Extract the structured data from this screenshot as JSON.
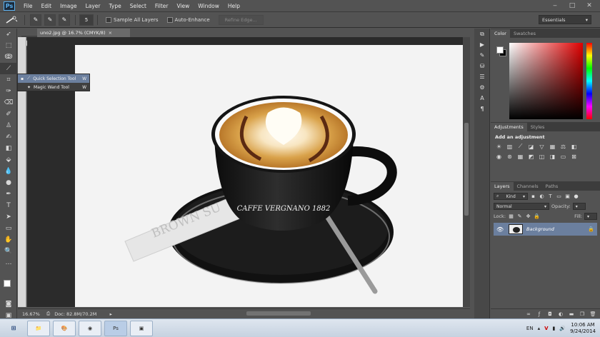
{
  "app": {
    "logo": "Ps"
  },
  "menu": [
    "File",
    "Edit",
    "Image",
    "Layer",
    "Type",
    "Select",
    "Filter",
    "View",
    "Window",
    "Help"
  ],
  "window_controls": {
    "minimize": "‒",
    "maximize": "□",
    "close": "✕"
  },
  "options_bar": {
    "brush_size": "5",
    "sample_all_layers": "Sample All Layers",
    "auto_enhance": "Auto-Enhance",
    "refine_edge": "Refine Edge...",
    "workspace": "Essentials"
  },
  "document": {
    "tab_title": "uno2.jpg @ 16.7% (CMYK/8)",
    "zoom": "16.67%",
    "doc_size": "Doc: 82.8M/70.2M"
  },
  "tool_flyout": {
    "items": [
      {
        "label": "Quick Selection Tool",
        "key": "W",
        "selected": true
      },
      {
        "label": "Magic Wand Tool",
        "key": "W",
        "selected": false
      }
    ]
  },
  "photo": {
    "cup_brand": "CAFFE VERGNANO 1882",
    "sugar_text": "BROWN SU"
  },
  "panels": {
    "color_tabs": [
      "Color",
      "Swatches"
    ],
    "adjustments_tabs": [
      "Adjustments",
      "Styles"
    ],
    "adjustments_title": "Add an adjustment",
    "layers_tabs": [
      "Layers",
      "Channels",
      "Paths"
    ],
    "layers_kind": "Kind",
    "blend_mode": "Normal",
    "opacity_label": "Opacity:",
    "lock_label": "Lock:",
    "fill_label": "Fill:",
    "layer_name": "Background"
  },
  "taskbar": {
    "language": "EN",
    "time": "10:06 AM",
    "date": "9/24/2014"
  }
}
